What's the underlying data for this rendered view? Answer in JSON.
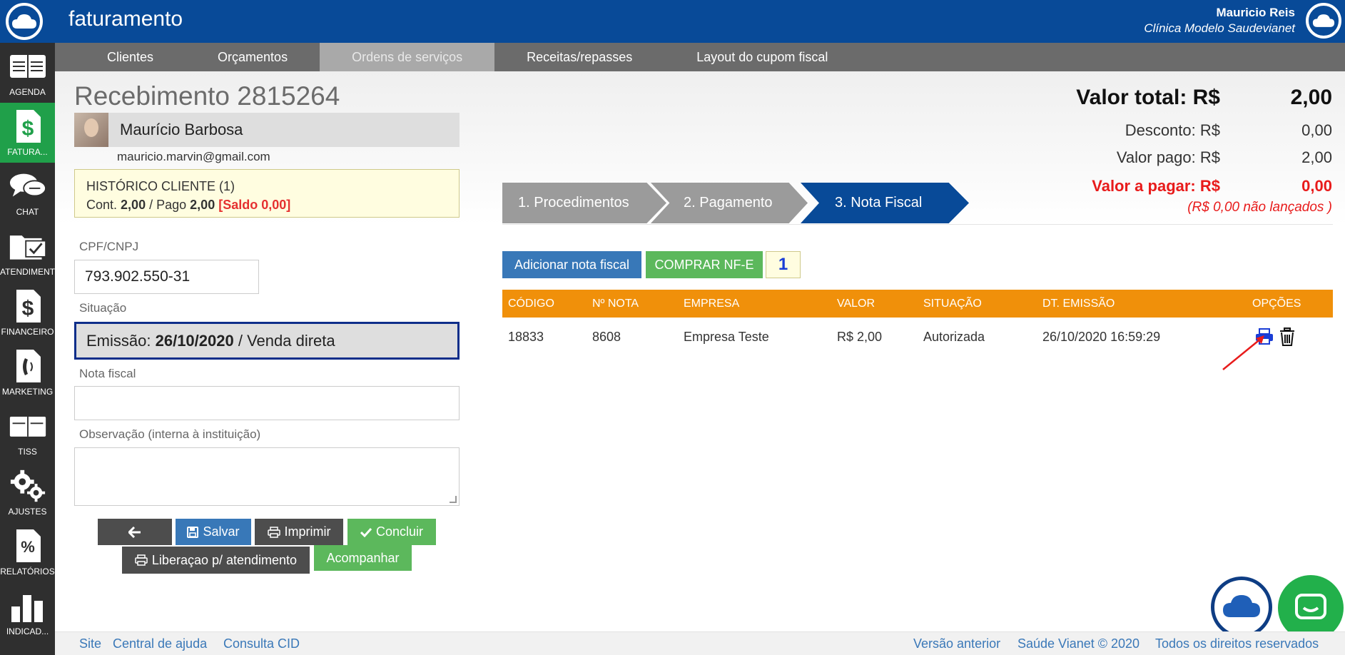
{
  "header": {
    "app_title": "faturamento",
    "user_name": "Mauricio Reis",
    "user_clinic": "Clínica Modelo Saudevianet"
  },
  "sidebar": {
    "items": [
      {
        "label": "AGENDA",
        "icon": "calendar-icon"
      },
      {
        "label": "FATURA...",
        "icon": "dollar-document-icon"
      },
      {
        "label": "CHAT",
        "icon": "chat-bubbles-icon"
      },
      {
        "label": "ATENDIMENTO",
        "icon": "folder-check-icon"
      },
      {
        "label": "FINANCEIRO",
        "icon": "dollar-document-icon"
      },
      {
        "label": "MARKETING",
        "icon": "phone-document-icon"
      },
      {
        "label": "TISS",
        "icon": "book-icon"
      },
      {
        "label": "AJUSTES",
        "icon": "gears-icon"
      },
      {
        "label": "RELATÓRIOS",
        "icon": "percent-document-icon"
      },
      {
        "label": "INDICAD...",
        "icon": "bar-chart-icon"
      }
    ]
  },
  "menu": {
    "items": [
      "Clientes",
      "Orçamentos",
      "Ordens de serviços",
      "Receitas/repasses",
      "Layout do cupom fiscal"
    ]
  },
  "page": {
    "title": "Recebimento 2815264"
  },
  "client": {
    "name": "Maurício Barbosa",
    "email": "mauricio.marvin@gmail.com"
  },
  "history": {
    "title": "HISTÓRICO CLIENTE (1)",
    "cont_label": "Cont.",
    "cont_value": "2,00",
    "sep": "/ Pago",
    "pago_value": "2,00",
    "saldo": "[Saldo 0,00]"
  },
  "form": {
    "cpf_label": "CPF/CNPJ",
    "cpf_value": "793.902.550-31",
    "situacao_label": "Situação",
    "situacao_prefix": "Emissão:",
    "situacao_date": "26/10/2020",
    "situacao_suffix": "/ Venda direta",
    "nota_label": "Nota fiscal",
    "nota_value": "",
    "obs_label": "Observação (interna à instituição)",
    "obs_value": ""
  },
  "actions": {
    "salvar": "Salvar",
    "imprimir": "Imprimir",
    "concluir": "Concluir",
    "liberacao": "Liberaçao p/ atendimento",
    "acompanhar": "Acompanhar"
  },
  "totals": {
    "total_label": "Valor total: R$",
    "total_value": "2,00",
    "desconto_label": "Desconto: R$",
    "desconto_value": "0,00",
    "pago_label": "Valor pago: R$",
    "pago_value": "2,00",
    "apagar_label": "Valor a pagar: R$",
    "apagar_value": "0,00",
    "nao_lancados": "(R$ 0,00  não lançados )"
  },
  "steps": [
    "1. Procedimentos",
    "2. Pagamento",
    "3. Nota Fiscal"
  ],
  "nf": {
    "add_label": "Adicionar nota fiscal",
    "comprar_label": "COMPRAR NF-E",
    "count": "1"
  },
  "table": {
    "columns": [
      "CÓDIGO",
      "Nº NOTA",
      "EMPRESA",
      "VALOR",
      "SITUAÇÃO",
      "DT. EMISSÃO",
      "OPÇÕES"
    ],
    "rows": [
      [
        "18833",
        "8608",
        "Empresa Teste",
        "R$ 2,00",
        "Autorizada",
        "26/10/2020 16:59:29"
      ]
    ]
  },
  "footer": {
    "links_left": [
      "Site",
      "Central de ajuda",
      "Consulta CID"
    ],
    "links_right": [
      "Versão anterior",
      "Saúde Vianet © 2020",
      "Todos os direitos reservados"
    ]
  },
  "colors": {
    "brand_blue": "#084a98",
    "active_green": "#20a04a",
    "table_orange": "#f0900a",
    "alert_red": "#e81b1b"
  }
}
